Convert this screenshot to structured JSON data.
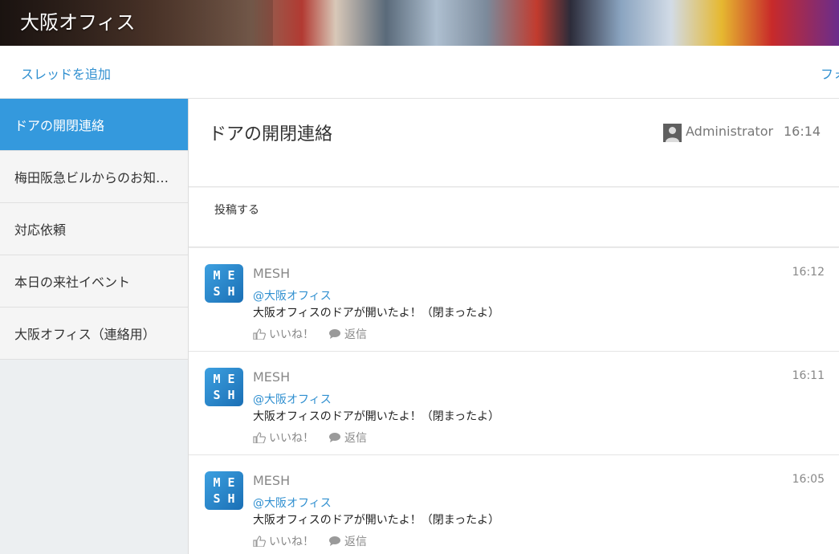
{
  "header": {
    "title": "大阪オフィス"
  },
  "toolbar": {
    "add_thread_label": "スレッドを追加",
    "follow_label": "フォ"
  },
  "sidebar": {
    "items": [
      {
        "label": "ドアの開閉連絡"
      },
      {
        "label": "梅田阪急ビルからのお知…"
      },
      {
        "label": "対応依頼"
      },
      {
        "label": "本日の来社イベント"
      },
      {
        "label": "大阪オフィス（連絡用）"
      }
    ]
  },
  "thread": {
    "title": "ドアの開閉連絡",
    "author": "Administrator",
    "time": "16:14",
    "post_label": "投稿する"
  },
  "messages": [
    {
      "avatar_letters": [
        "M",
        "E",
        "S",
        "H"
      ],
      "sender": "MESH",
      "time": "16:12",
      "mention": "@大阪オフィス",
      "body": "大阪オフィスのドアが開いたよ！（閉まったよ）",
      "like_label": "いいね！",
      "reply_label": "返信"
    },
    {
      "avatar_letters": [
        "M",
        "E",
        "S",
        "H"
      ],
      "sender": "MESH",
      "time": "16:11",
      "mention": "@大阪オフィス",
      "body": "大阪オフィスのドアが開いたよ！（閉まったよ）",
      "like_label": "いいね！",
      "reply_label": "返信"
    },
    {
      "avatar_letters": [
        "M",
        "E",
        "S",
        "H"
      ],
      "sender": "MESH",
      "time": "16:05",
      "mention": "@大阪オフィス",
      "body": "大阪オフィスのドアが開いたよ！（閉まったよ）",
      "like_label": "いいね！",
      "reply_label": "返信"
    }
  ],
  "colors": {
    "accent": "#3499dd",
    "link": "#2f8fd0",
    "sidebar_bg": "#eceff1"
  },
  "icons": {
    "author": "user-icon",
    "like": "thumbs-up-icon",
    "reply": "speech-bubble-icon"
  }
}
